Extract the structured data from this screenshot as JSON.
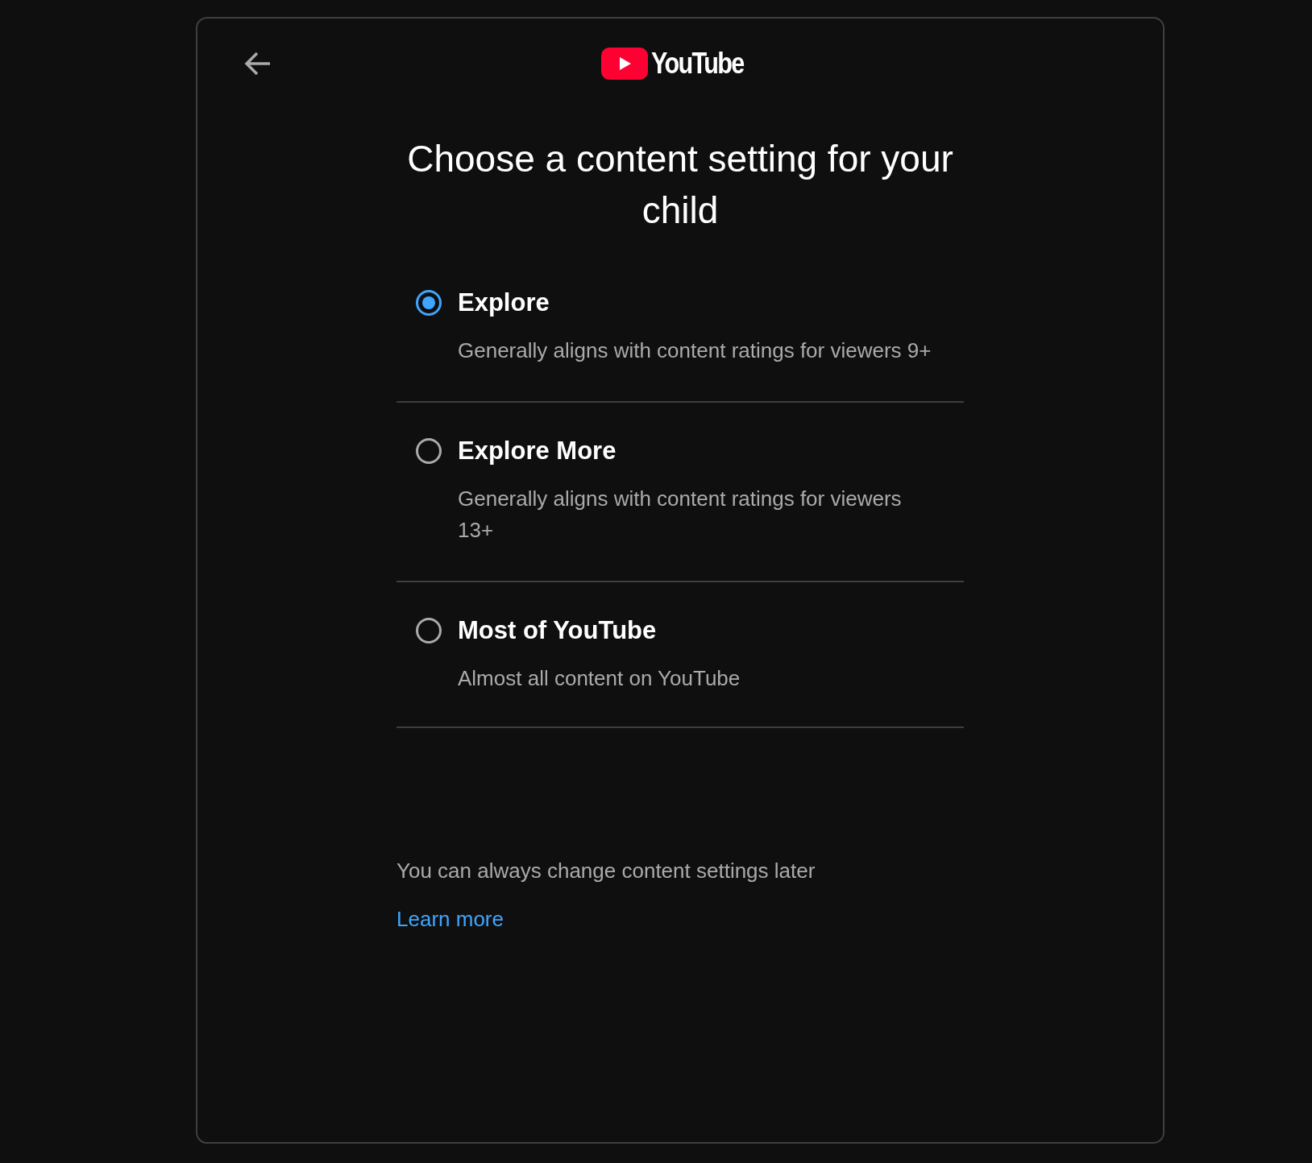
{
  "header": {
    "logo_text": "YouTube"
  },
  "title": "Choose a content setting for your child",
  "options": [
    {
      "label": "Explore",
      "description": "Generally aligns with content ratings for viewers 9+",
      "selected": true
    },
    {
      "label": "Explore More",
      "description": "Generally aligns with content ratings for viewers 13+",
      "selected": false
    },
    {
      "label": "Most of YouTube",
      "description": "Almost all content on YouTube",
      "selected": false
    }
  ],
  "footer": {
    "note": "You can always change content settings later",
    "link": "Learn more"
  }
}
